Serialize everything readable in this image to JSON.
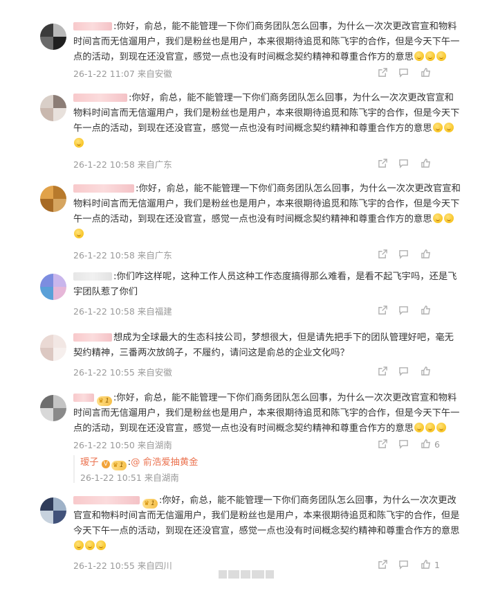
{
  "comments": [
    {
      "sep": ":",
      "text": "你好，俞总，能不能管理一下你们商务团队怎么回事，为什么一次次更改官宣和物料时间言而无信遛用户，我们是粉丝也是用户，本来很期待追觅和陈飞宇的合作，但是今天下午一点的活动，到现在还没官宣，感觉一点也没有时间概念契约精神和尊重合作方的意思",
      "meta": "26-1-22 11:07 来自安徽",
      "like_count": ""
    },
    {
      "sep": ":",
      "text": "你好，俞总，能不能管理一下你们商务团队怎么回事，为什么一次次更改官宣和物料时间言而无信遛用户，我们是粉丝也是用户，本来很期待追觅和陈飞宇的合作，但是今天下午一点的活动，到现在还没官宣，感觉一点也没有时间概念契约精神和尊重合作方的意思",
      "meta": "26-1-22 10:58 来自广东",
      "like_count": ""
    },
    {
      "sep": ":",
      "text": "你好，俞总，能不能管理一下你们商务团队怎么回事，为什么一次次更改官宣和物料时间言而无信遛用户，我们是粉丝也是用户，本来很期待追觅和陈飞宇的合作，但是今天下午一点的活动，到现在还没官宣，感觉一点也没有时间概念契约精神和尊重合作方的意思",
      "meta": "26-1-22 10:58 来自广东",
      "like_count": ""
    },
    {
      "sep": ":",
      "text": "你们咋这样呢，这种工作人员这种工作态度搞得那么难看，是看不起飞宇吗，还是飞宇团队惹了你们",
      "meta": "26-1-22 10:58 来自福建",
      "like_count": ""
    },
    {
      "sep": "",
      "text": "想成为全球最大的生态科技公司，梦想很大，但是请先把手下的团队管理好吧，毫无契约精神，三番两次放鸽子，不履约，请问这是俞总的企业文化吗？",
      "meta": "26-1-22 10:55 来自安徽",
      "like_count": ""
    },
    {
      "sep": ":",
      "badge": "1",
      "text": "你好，俞总，能不能管理一下你们商务团队怎么回事，为什么一次次更改官宣和物料时间言而无信遛用户，我们是粉丝也是用户，本来很期待追觅和陈飞宇的合作，但是今天下午一点的活动，到现在还没官宣，感觉一点也没有时间概念契约精神和尊重合作方的意思",
      "meta": "26-1-22 10:50 来自湖南",
      "like_count": "6"
    },
    {
      "sep": ":",
      "badge": "1",
      "text": "你好，俞总，能不能管理一下你们商务团队怎么回事，为什么一次次更改官宣和物料时间言而无信遛用户，我们是粉丝也是用户，本来很期待追觅和陈飞宇的合作，但是今天下午一点的活动，到现在还没官宣，感觉一点也没有时间概念契约精神和尊重合作方的意思",
      "meta": "26-1-22 10:55 来自四川",
      "like_count": "1"
    }
  ],
  "reply": {
    "name": "瑷子",
    "badge": "1",
    "sep": ":",
    "mention": "@ 俞浩爱抽黄金",
    "meta": "26-1-22 10:51 来自湖南"
  },
  "icons": {
    "share": "share-icon",
    "comment": "comment-icon",
    "like": "thumbs-up-icon",
    "emoji": "grin-emoji-icon",
    "crown": "crown-icon"
  },
  "colors": {
    "meta_text": "#999999",
    "mention": "#eb7350",
    "badge": "#f6c04a"
  }
}
